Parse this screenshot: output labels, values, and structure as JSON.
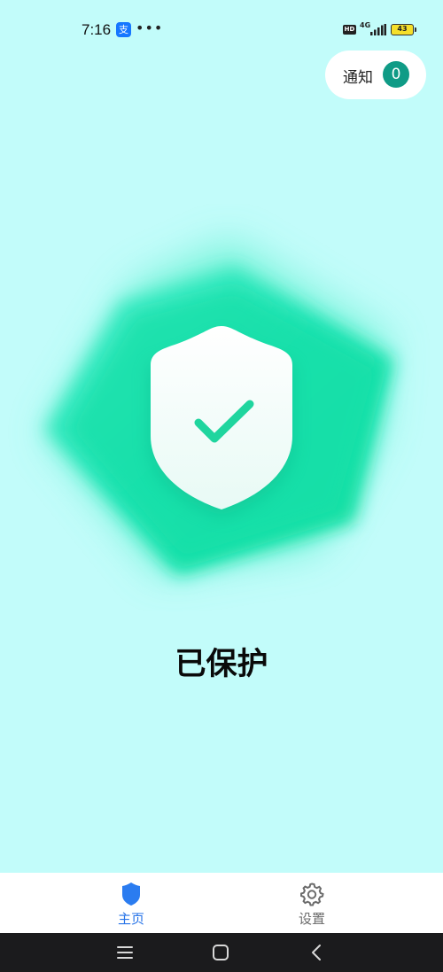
{
  "status_bar": {
    "time": "7:16",
    "alipay_glyph": "支",
    "more": "•••",
    "hd": "HD",
    "network": "4G",
    "battery": "43"
  },
  "notice": {
    "label": "通知",
    "count": "0"
  },
  "hero": {
    "status_title": "已保护",
    "icon": "shield-check-icon",
    "accent_color": "#18e0b0"
  },
  "tab_bar": {
    "tabs": [
      {
        "label": "主页",
        "icon": "shield-icon",
        "active": true
      },
      {
        "label": "设置",
        "icon": "gear-icon",
        "active": false
      }
    ],
    "active_color": "#2673e8",
    "inactive_color": "#6b6b6b"
  },
  "nav_bar": {
    "buttons": [
      "menu-icon",
      "home-icon",
      "back-icon"
    ]
  },
  "colors": {
    "background": "#c2fcfa",
    "notice_badge": "#0f9b86"
  }
}
